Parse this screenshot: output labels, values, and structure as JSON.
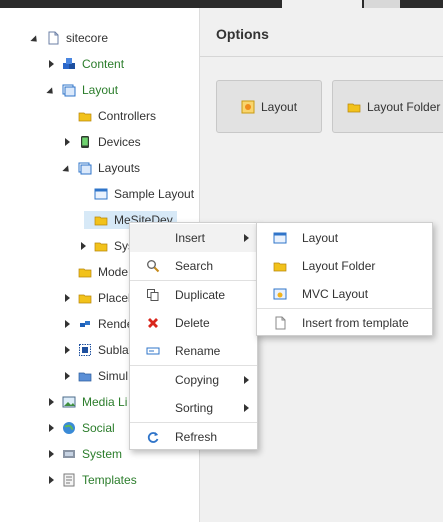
{
  "tree": {
    "items": [
      {
        "label": "sitecore",
        "icon": "document-icon",
        "state": "expanded"
      },
      {
        "label": "Content",
        "icon": "cubes-icon",
        "state": "collapsed"
      },
      {
        "label": "Layout",
        "icon": "layout-window-icon",
        "state": "expanded"
      },
      {
        "label": "Controllers",
        "icon": "folder-icon",
        "state": "none"
      },
      {
        "label": "Devices",
        "icon": "phone-icon",
        "state": "collapsed"
      },
      {
        "label": "Layouts",
        "icon": "layout-window-icon",
        "state": "expanded"
      },
      {
        "label": "Sample Layout",
        "icon": "window-icon",
        "state": "none"
      },
      {
        "label": "MeSiteDev",
        "icon": "folder-icon",
        "state": "none",
        "selected": true
      },
      {
        "label": "Sys",
        "icon": "folder-icon",
        "state": "collapsed"
      },
      {
        "label": "Mode",
        "icon": "folder-icon",
        "state": "none"
      },
      {
        "label": "Placeh",
        "icon": "folder-icon",
        "state": "collapsed"
      },
      {
        "label": "Rende",
        "icon": "blocks-icon",
        "state": "collapsed"
      },
      {
        "label": "Sublay",
        "icon": "sublayout-icon",
        "state": "collapsed"
      },
      {
        "label": "Simul",
        "icon": "folder-blue-icon",
        "state": "collapsed"
      },
      {
        "label": "Media Li",
        "icon": "image-icon",
        "state": "collapsed"
      },
      {
        "label": "Social",
        "icon": "globe-icon",
        "state": "collapsed"
      },
      {
        "label": "System",
        "icon": "gears-icon",
        "state": "collapsed"
      },
      {
        "label": "Templates",
        "icon": "template-icon",
        "state": "collapsed"
      }
    ]
  },
  "options": {
    "title": "Options",
    "buttons": [
      {
        "label": "Layout",
        "icon": "layout-icon"
      },
      {
        "label": "Layout Folder",
        "icon": "folder-icon"
      }
    ]
  },
  "context_menu": {
    "items": [
      {
        "label": "Insert",
        "icon": "",
        "submenu": true
      },
      {
        "label": "Search",
        "icon": "search-icon",
        "submenu": false
      },
      {
        "label": "Duplicate",
        "icon": "duplicate-icon",
        "submenu": false
      },
      {
        "label": "Delete",
        "icon": "delete-icon",
        "submenu": false
      },
      {
        "label": "Rename",
        "icon": "rename-icon",
        "submenu": false
      },
      {
        "label": "Copying",
        "icon": "",
        "submenu": true
      },
      {
        "label": "Sorting",
        "icon": "",
        "submenu": true
      },
      {
        "label": "Refresh",
        "icon": "refresh-icon",
        "submenu": false
      }
    ]
  },
  "insert_submenu": {
    "items": [
      {
        "label": "Layout",
        "icon": "window-icon"
      },
      {
        "label": "Layout Folder",
        "icon": "folder-icon"
      },
      {
        "label": "MVC Layout",
        "icon": "mvc-layout-icon"
      },
      {
        "label": "Insert from template",
        "icon": "blank-document-icon"
      }
    ]
  },
  "colors": {
    "tree_green": "#2b7d2b",
    "selection": "#d7e9f7",
    "delete_red": "#d9261c",
    "folder_yellow": "#f2c21b"
  }
}
